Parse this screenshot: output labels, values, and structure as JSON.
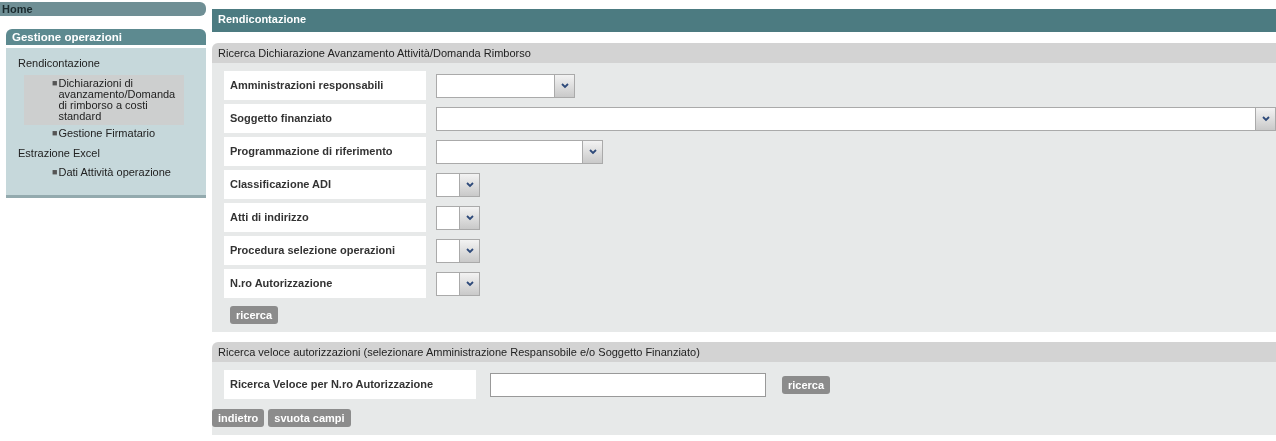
{
  "sidebar": {
    "home": "Home",
    "section": "Gestione operazioni",
    "groups": [
      {
        "label": "Rendicontazione",
        "children": [
          {
            "marker": "■",
            "label": "Dichiarazioni di avanzamento/Domanda di rimborso a costi standard",
            "selected": true
          },
          {
            "marker": "■",
            "label": "Gestione Firmatario",
            "selected": false
          }
        ]
      },
      {
        "label": "Estrazione Excel",
        "children": [
          {
            "marker": "■",
            "label": "Dati Attività operazione",
            "selected": false
          }
        ]
      }
    ]
  },
  "page_title": "Rendicontazione",
  "search": {
    "title": "Ricerca Dichiarazione Avanzamento Attività/Domanda Rimborso",
    "fields": [
      {
        "label": "Amministrazioni responsabili"
      },
      {
        "label": "Soggetto finanziato"
      },
      {
        "label": "Programmazione di riferimento"
      },
      {
        "label": "Classificazione ADI"
      },
      {
        "label": "Atti di indirizzo"
      },
      {
        "label": "Procedura selezione operazioni"
      },
      {
        "label": "N.ro Autorizzazione"
      }
    ],
    "button": "ricerca"
  },
  "quick": {
    "title": "Ricerca veloce autorizzazioni (selezionare Amministrazione Respansobile e/o Soggetto Finanziato)",
    "label": "Ricerca Veloce per N.ro Autorizzazione",
    "button": "ricerca"
  },
  "actions": [
    "indietro",
    "svuota campi"
  ]
}
